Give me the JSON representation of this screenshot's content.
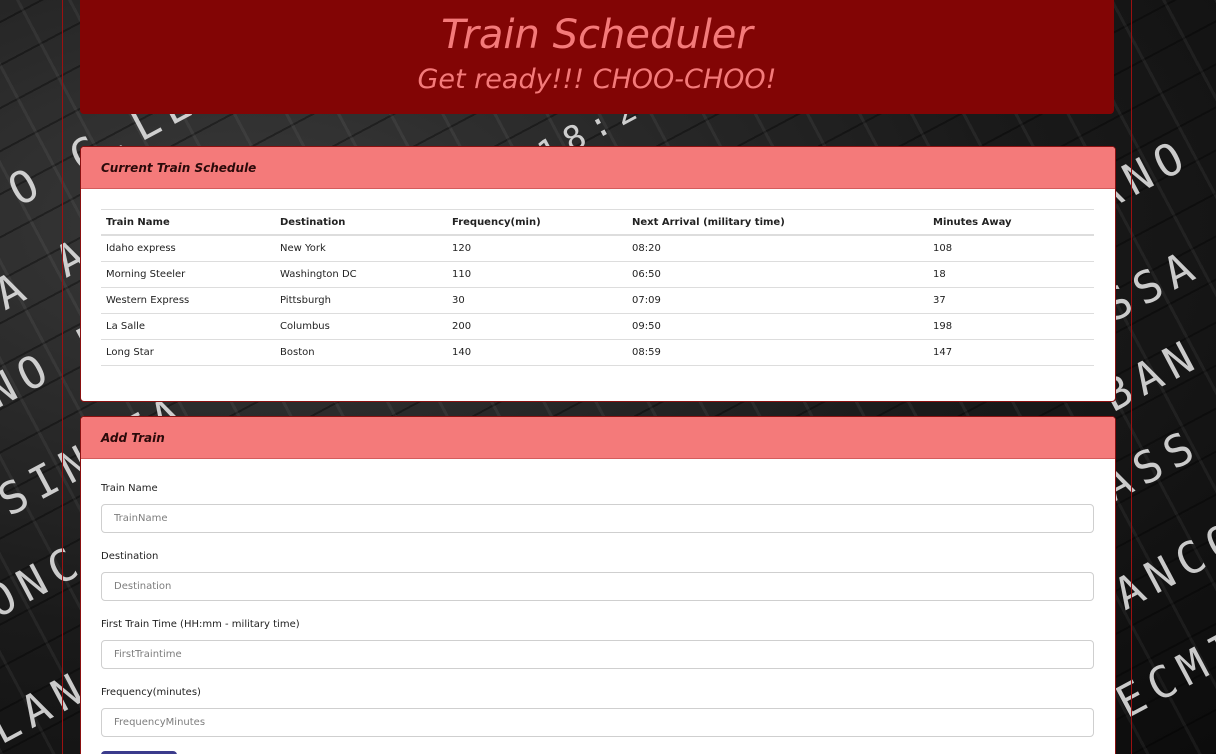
{
  "header": {
    "title": "Train Scheduler",
    "subtitle": "Get ready!!! CHOO-CHOO!"
  },
  "schedule": {
    "heading": "Current Train Schedule",
    "columns": [
      "Train Name",
      "Destination",
      "Frequency(min)",
      "Next Arrival (military time)",
      "Minutes Away"
    ],
    "rows": [
      [
        "Idaho express",
        "New York",
        "120",
        "08:20",
        "108"
      ],
      [
        "Morning Steeler",
        "Washington DC",
        "110",
        "06:50",
        "18"
      ],
      [
        "Western Express",
        "Pittsburgh",
        "30",
        "07:09",
        "37"
      ],
      [
        "La Salle",
        "Columbus",
        "200",
        "09:50",
        "198"
      ],
      [
        "Long Star",
        "Boston",
        "140",
        "08:59",
        "147"
      ]
    ]
  },
  "add_train": {
    "heading": "Add Train",
    "fields": [
      {
        "label": "Train Name",
        "placeholder": "TrainName",
        "value": ""
      },
      {
        "label": "Destination",
        "placeholder": "Destination",
        "value": ""
      },
      {
        "label": "First Train Time (HH:mm - military time)",
        "placeholder": "FirstTraintime",
        "value": ""
      },
      {
        "label": "Frequency(minutes)",
        "placeholder": "FrequencyMinutes",
        "value": ""
      }
    ]
  },
  "colors": {
    "jumbotron": "#820505",
    "title_text": "#f47a7a",
    "card_header": "#f47a7a",
    "border": "#8a1010",
    "submit_button": "#3b3b8c"
  }
}
